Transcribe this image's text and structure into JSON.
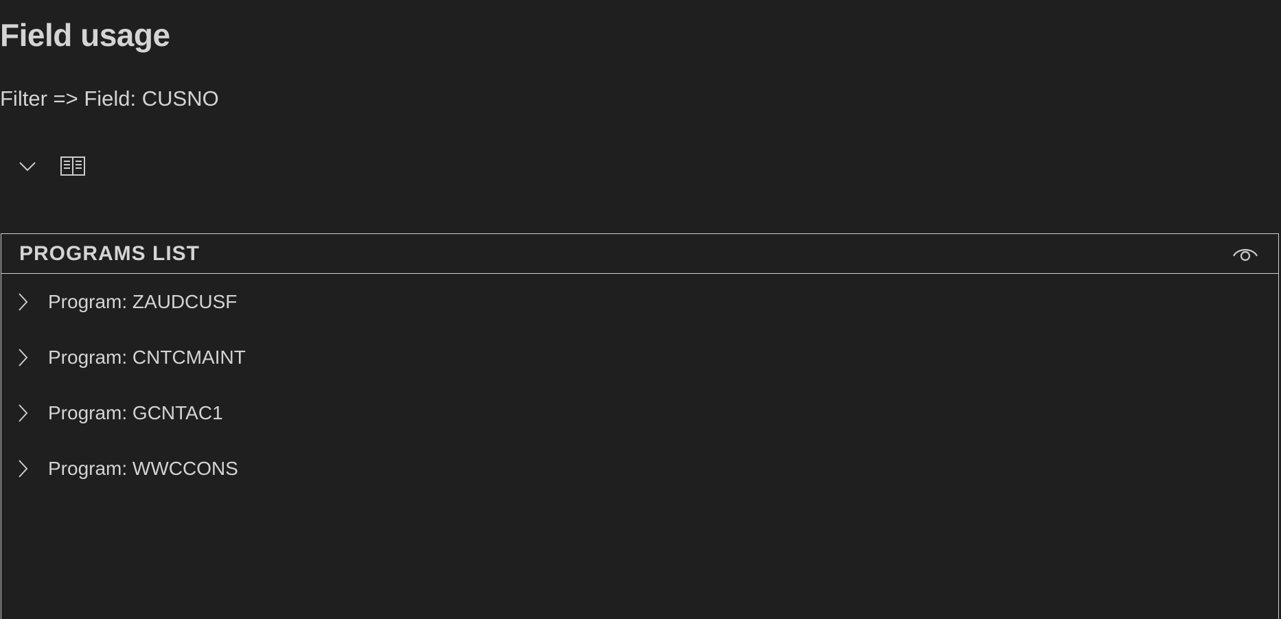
{
  "header": {
    "title": "Field usage",
    "filter_text": "Filter => Field: CUSNO"
  },
  "toolbar": {
    "collapse_icon": "chevron-down-icon",
    "book_icon": "book-open-icon"
  },
  "panel": {
    "title": "PROGRAMS LIST",
    "eye_icon": "eye-icon",
    "items": [
      {
        "label": "Program: ZAUDCUSF",
        "icon": "chevron-right-icon"
      },
      {
        "label": "Program: CNTCMAINT",
        "icon": "chevron-right-icon"
      },
      {
        "label": "Program: GCNTAC1",
        "icon": "chevron-right-icon"
      },
      {
        "label": "Program: WWCCONS",
        "icon": "chevron-right-icon"
      }
    ]
  },
  "colors": {
    "background": "#1f1f1f",
    "text": "#d4d4d4",
    "border": "#cfcfcf"
  }
}
